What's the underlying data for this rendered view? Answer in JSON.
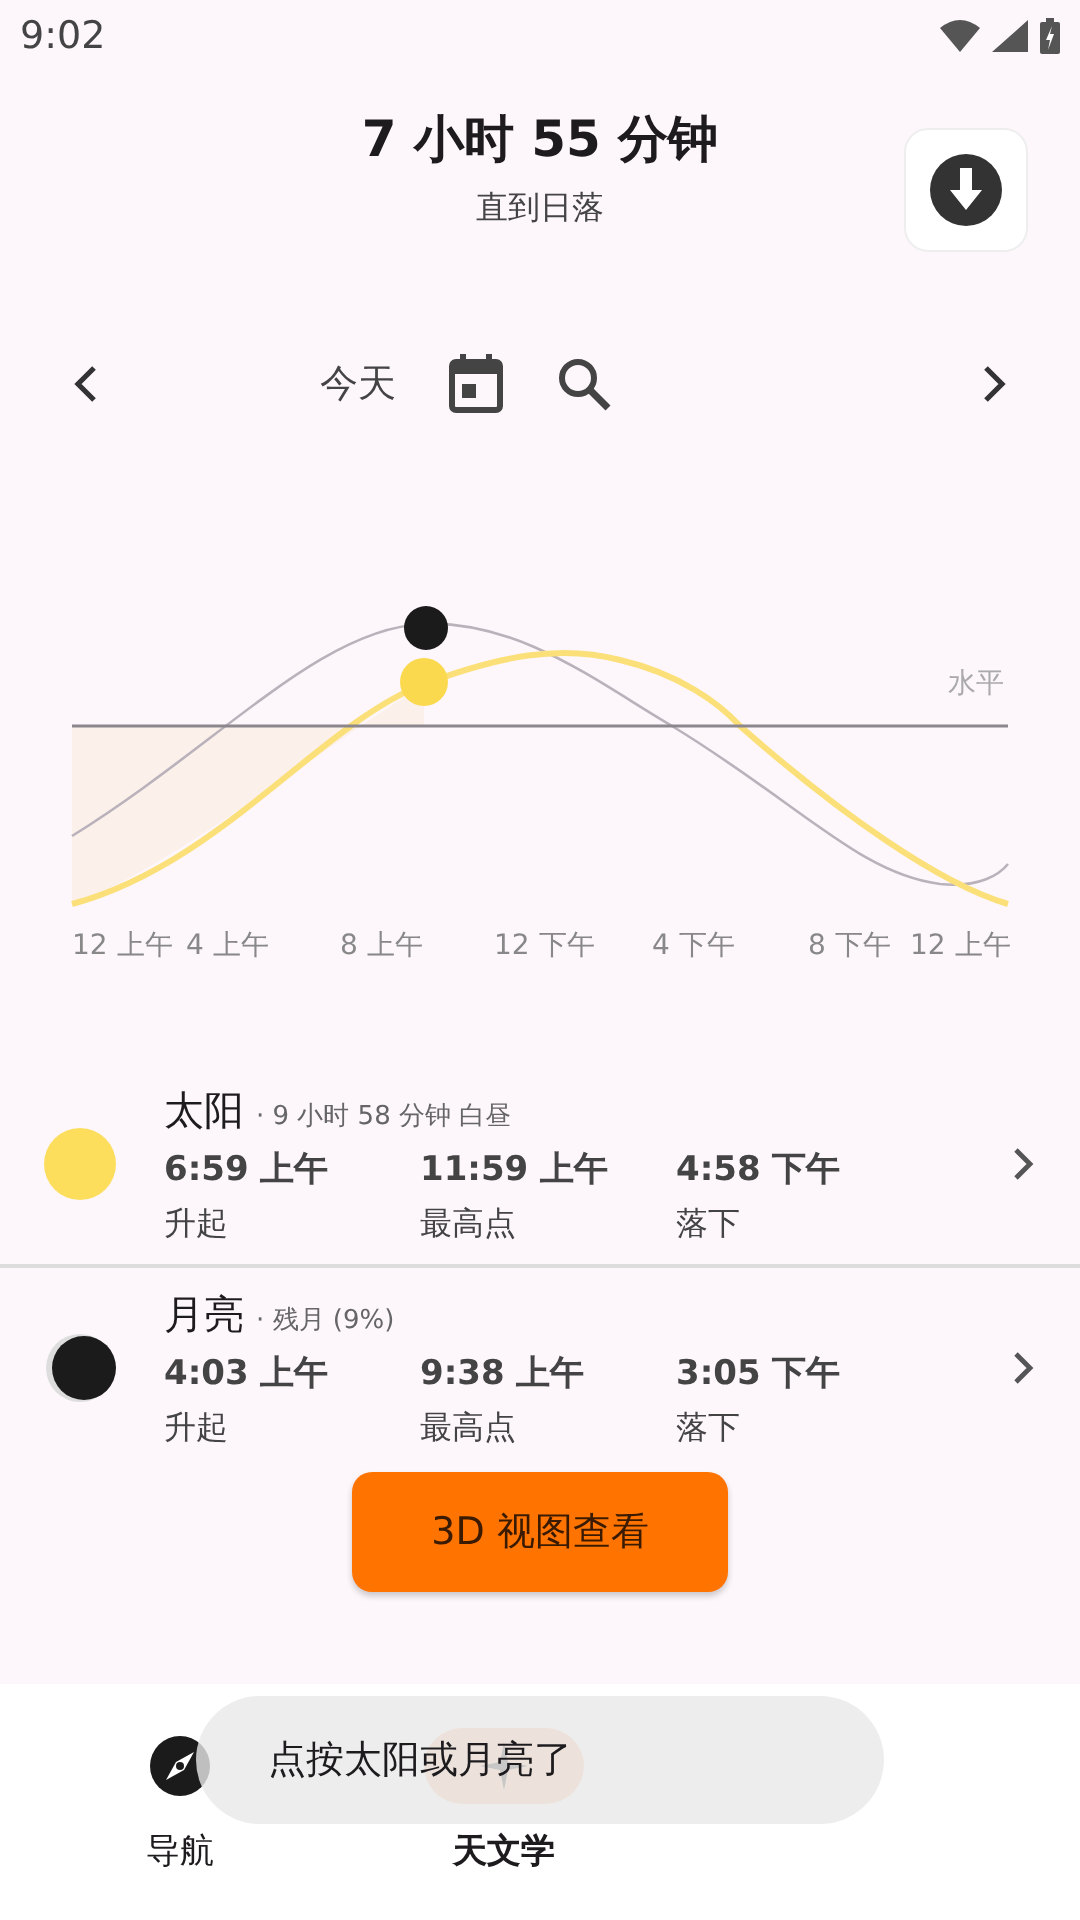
{
  "status_bar": {
    "time": "9:02"
  },
  "header": {
    "title": "7 小时 55 分钟",
    "subtitle": "直到日落"
  },
  "date_nav": {
    "label": "今天"
  },
  "chart": {
    "horizon_label": "水平",
    "x_labels": [
      "12 上午",
      "4 上午",
      "8 上午",
      "12 下午",
      "4 下午",
      "8 下午",
      "12 上午"
    ]
  },
  "bodies": [
    {
      "kind": "sun",
      "name": "太阳",
      "detail": "· 9 小时 58 分钟 白昼",
      "events": [
        {
          "time": "6:59 上午",
          "label": "升起"
        },
        {
          "time": "11:59 上午",
          "label": "最高点"
        },
        {
          "time": "4:58 下午",
          "label": "落下"
        }
      ]
    },
    {
      "kind": "moon",
      "name": "月亮",
      "detail": "· 残月 (9%)",
      "events": [
        {
          "time": "4:03 上午",
          "label": "升起"
        },
        {
          "time": "9:38 上午",
          "label": "最高点"
        },
        {
          "time": "3:05 下午",
          "label": "落下"
        }
      ]
    }
  ],
  "view_3d_button": "3D 视图查看",
  "bottom_nav": [
    {
      "label": "导航",
      "kind": "compass",
      "selected": false
    },
    {
      "label": "天文学",
      "kind": "sparkle",
      "selected": true
    }
  ],
  "toast": "点按太阳或月亮了"
}
